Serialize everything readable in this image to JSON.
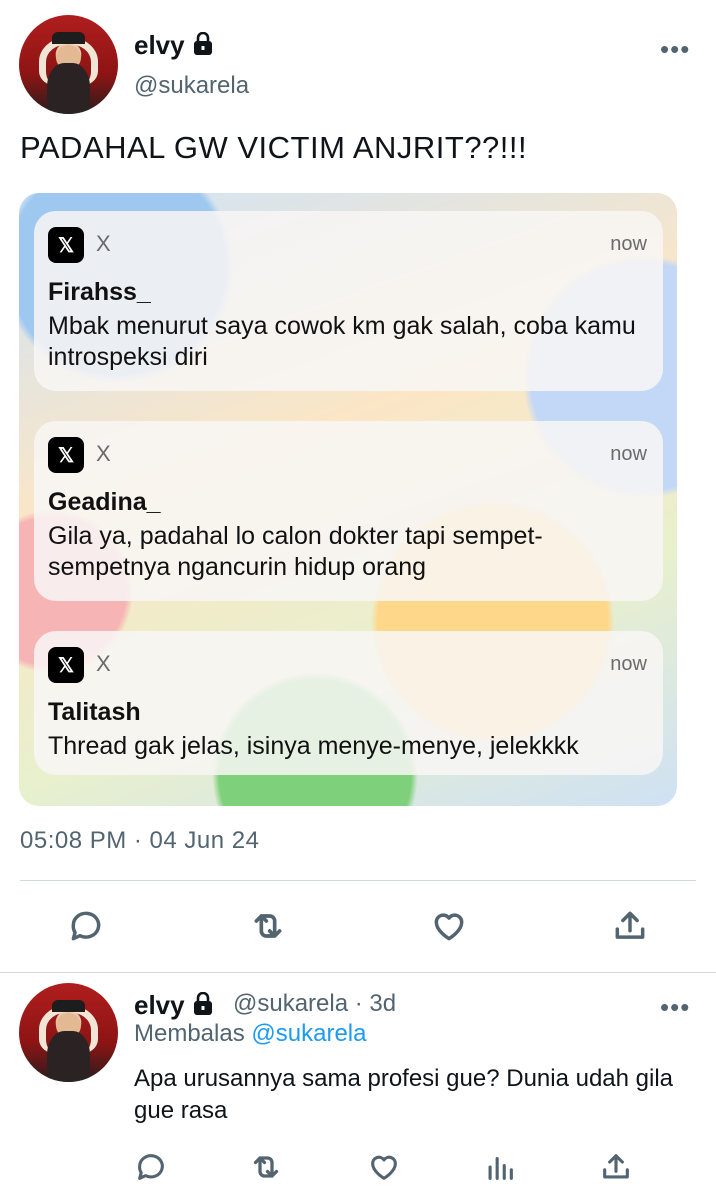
{
  "tweet": {
    "display_name": "elvy",
    "handle": "@sukarela",
    "more": "•••",
    "text": "PADAHAL GW VICTIM ANJRIT??!!!",
    "timestamp": "05:08 PM · 04 Jun 24",
    "notifications": [
      {
        "app": "X",
        "time": "now",
        "name": "Firahss_",
        "message": "Mbak menurut saya cowok km gak salah, coba kamu introspeksi diri"
      },
      {
        "app": "X",
        "time": "now",
        "name": "Geadina_",
        "message": "Gila ya, padahal lo calon dokter tapi sempet-sempetnya ngancurin hidup orang"
      },
      {
        "app": "X",
        "time": "now",
        "name": "Talitash",
        "message": "Thread gak jelas, isinya menye-menye, jelekkkk"
      }
    ],
    "actions": [
      "reply-icon",
      "retweet-icon",
      "like-icon",
      "share-icon"
    ]
  },
  "reply": {
    "display_name": "elvy",
    "handle_time": "@sukarela · 3d",
    "more": "•••",
    "replying_prefix": "Membalas",
    "replying_to": "@sukarela",
    "text": "Apa urusannya sama profesi gue? Dunia udah gila gue rasa",
    "actions": [
      "reply-icon",
      "retweet-icon",
      "like-icon",
      "views-icon",
      "share-icon"
    ]
  },
  "colors": {
    "text": "#0f1419",
    "secondary": "#536471",
    "link": "#1d9bf0",
    "divider": "#cfd9de"
  }
}
